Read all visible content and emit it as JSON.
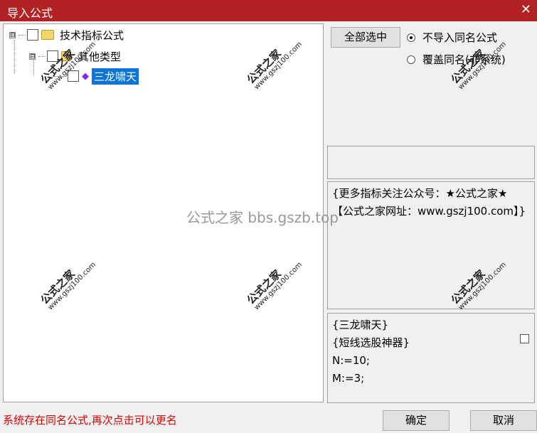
{
  "window": {
    "title": "导入公式",
    "close_glyph": "✕"
  },
  "tree": {
    "root": {
      "expander": "⊟",
      "label": "技术指标公式"
    },
    "group": {
      "expander": "⊟",
      "label": "其他类型"
    },
    "leaf": {
      "label": "三龙啸天"
    }
  },
  "options": {
    "select_all": "全部选中",
    "radio_skip": "不导入同名公式",
    "radio_overwrite": "覆盖同名(非系统)"
  },
  "description": "{更多指标关注公众号：★公式之家★ 【公式之家网址：www.gszj100.com】}",
  "code_lines": [
    "{三龙啸天}",
    "{短线选股神器}",
    "N:=10;",
    "M:=3;"
  ],
  "status_message": "系统存在同名公式,再次点击可以更名",
  "buttons": {
    "ok": "确定",
    "cancel": "取消"
  },
  "watermark": {
    "text_big": "公式之家",
    "text_small": "www.gszj100.com",
    "center_text": "公式之家 bbs.gszb.top"
  }
}
